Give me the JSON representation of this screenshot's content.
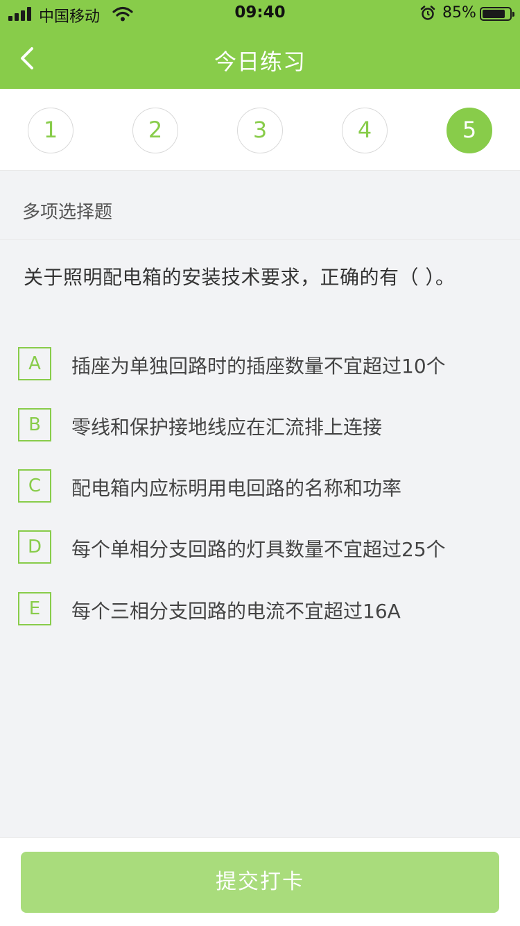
{
  "status_bar": {
    "carrier": "中国移动",
    "time": "09:40",
    "battery_percent": "85%",
    "battery_level": 0.85,
    "icons": [
      "signal-icon",
      "wifi-icon",
      "alarm-icon",
      "battery-icon"
    ]
  },
  "nav": {
    "title": "今日练习",
    "back_icon": "chevron-left-icon"
  },
  "question_tabs": [
    {
      "label": "1",
      "active": false
    },
    {
      "label": "2",
      "active": false
    },
    {
      "label": "3",
      "active": false
    },
    {
      "label": "4",
      "active": false
    },
    {
      "label": "5",
      "active": true
    }
  ],
  "question": {
    "type_label": "多项选择题",
    "text": "关于照明配电箱的安装技术要求，正确的有（    ）。",
    "options": [
      {
        "letter": "A",
        "text": "插座为单独回路时的插座数量不宜超过10个"
      },
      {
        "letter": "B",
        "text": "零线和保护接地线应在汇流排上连接"
      },
      {
        "letter": "C",
        "text": "配电箱内应标明用电回路的名称和功率"
      },
      {
        "letter": "D",
        "text": "每个单相分支回路的灯具数量不宜超过25个"
      },
      {
        "letter": "E",
        "text": "每个三相分支回路的电流不宜超过16A"
      }
    ]
  },
  "footer": {
    "submit_label": "提交打卡"
  },
  "colors": {
    "primary": "#88cc4a",
    "button_disabled": "#a9dc7c",
    "background": "#f2f3f5"
  }
}
